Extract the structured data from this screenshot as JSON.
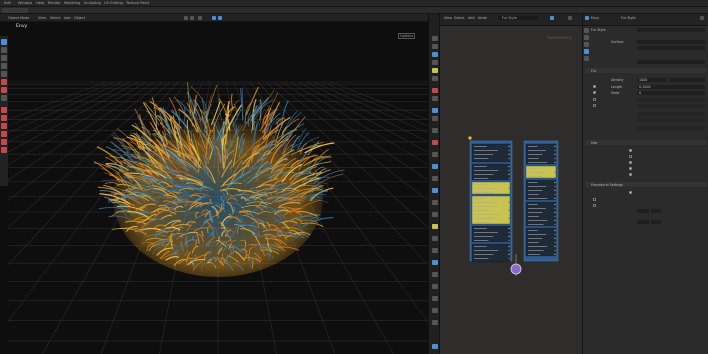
{
  "topbar": {
    "menus": [
      "Edit",
      "Window",
      "Help",
      "Render",
      "Modeling",
      "Sculpting",
      "UV Editing",
      "Texture Paint"
    ]
  },
  "viewport": {
    "label": "Envy",
    "mode": "Object Mode",
    "view_menu": "View",
    "select_menu": "Select",
    "add_menu": "Add",
    "object_menu": "Object",
    "options": "Options"
  },
  "node_editor": {
    "title": "Geometry",
    "header_menus": [
      "View",
      "Select",
      "Add",
      "Node"
    ],
    "node_group": "Fur Style"
  },
  "properties": {
    "object_name": "Envy",
    "modifier_name": "Fur Style",
    "sections": [
      "Fur",
      "Hair",
      "Procedural Settings"
    ],
    "fields": {
      "surface": "Surface",
      "density": "Density",
      "length": "Length",
      "seed": "Seed"
    },
    "values": {
      "length_value": "0.1000",
      "density_value": "1000",
      "seed_value": "0"
    }
  },
  "colors": {
    "accent_blue": "#4a90d9",
    "fur_yellow": "#e8a428",
    "fur_blue": "#3d8fc4",
    "node_blue": "#2f5d95",
    "node_yellow": "#c9c451"
  }
}
